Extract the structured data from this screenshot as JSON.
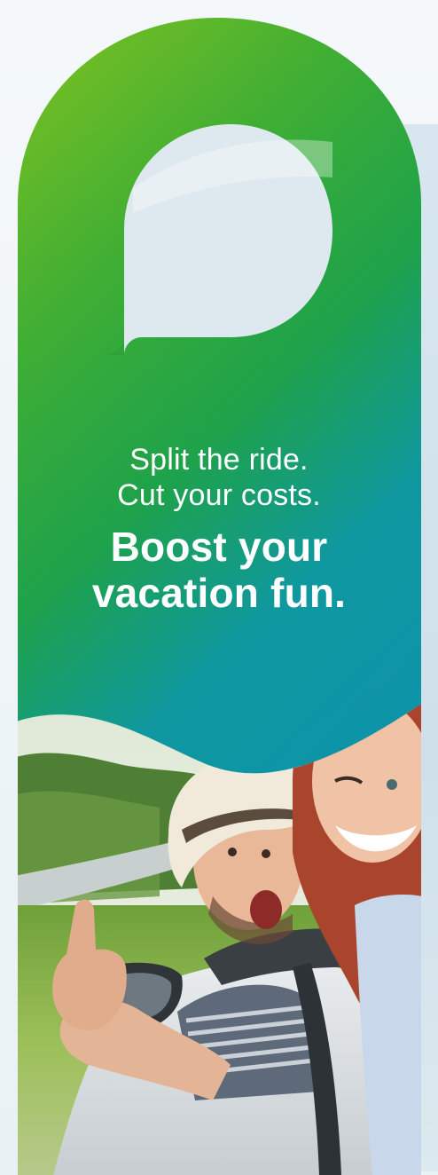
{
  "hanger": {
    "tagline_line1": "Split the ride.",
    "tagline_line2": "Cut your costs.",
    "headline_line1": "Boost your",
    "headline_line2": "vacation fun."
  },
  "colors": {
    "green_top": "#7dc020",
    "green_mid": "#34a83a",
    "teal_bottom": "#0e97a8",
    "hole": "#dde9ef",
    "text": "#ffffff"
  },
  "icons": [
    "thumbs-up-photo-icon"
  ]
}
